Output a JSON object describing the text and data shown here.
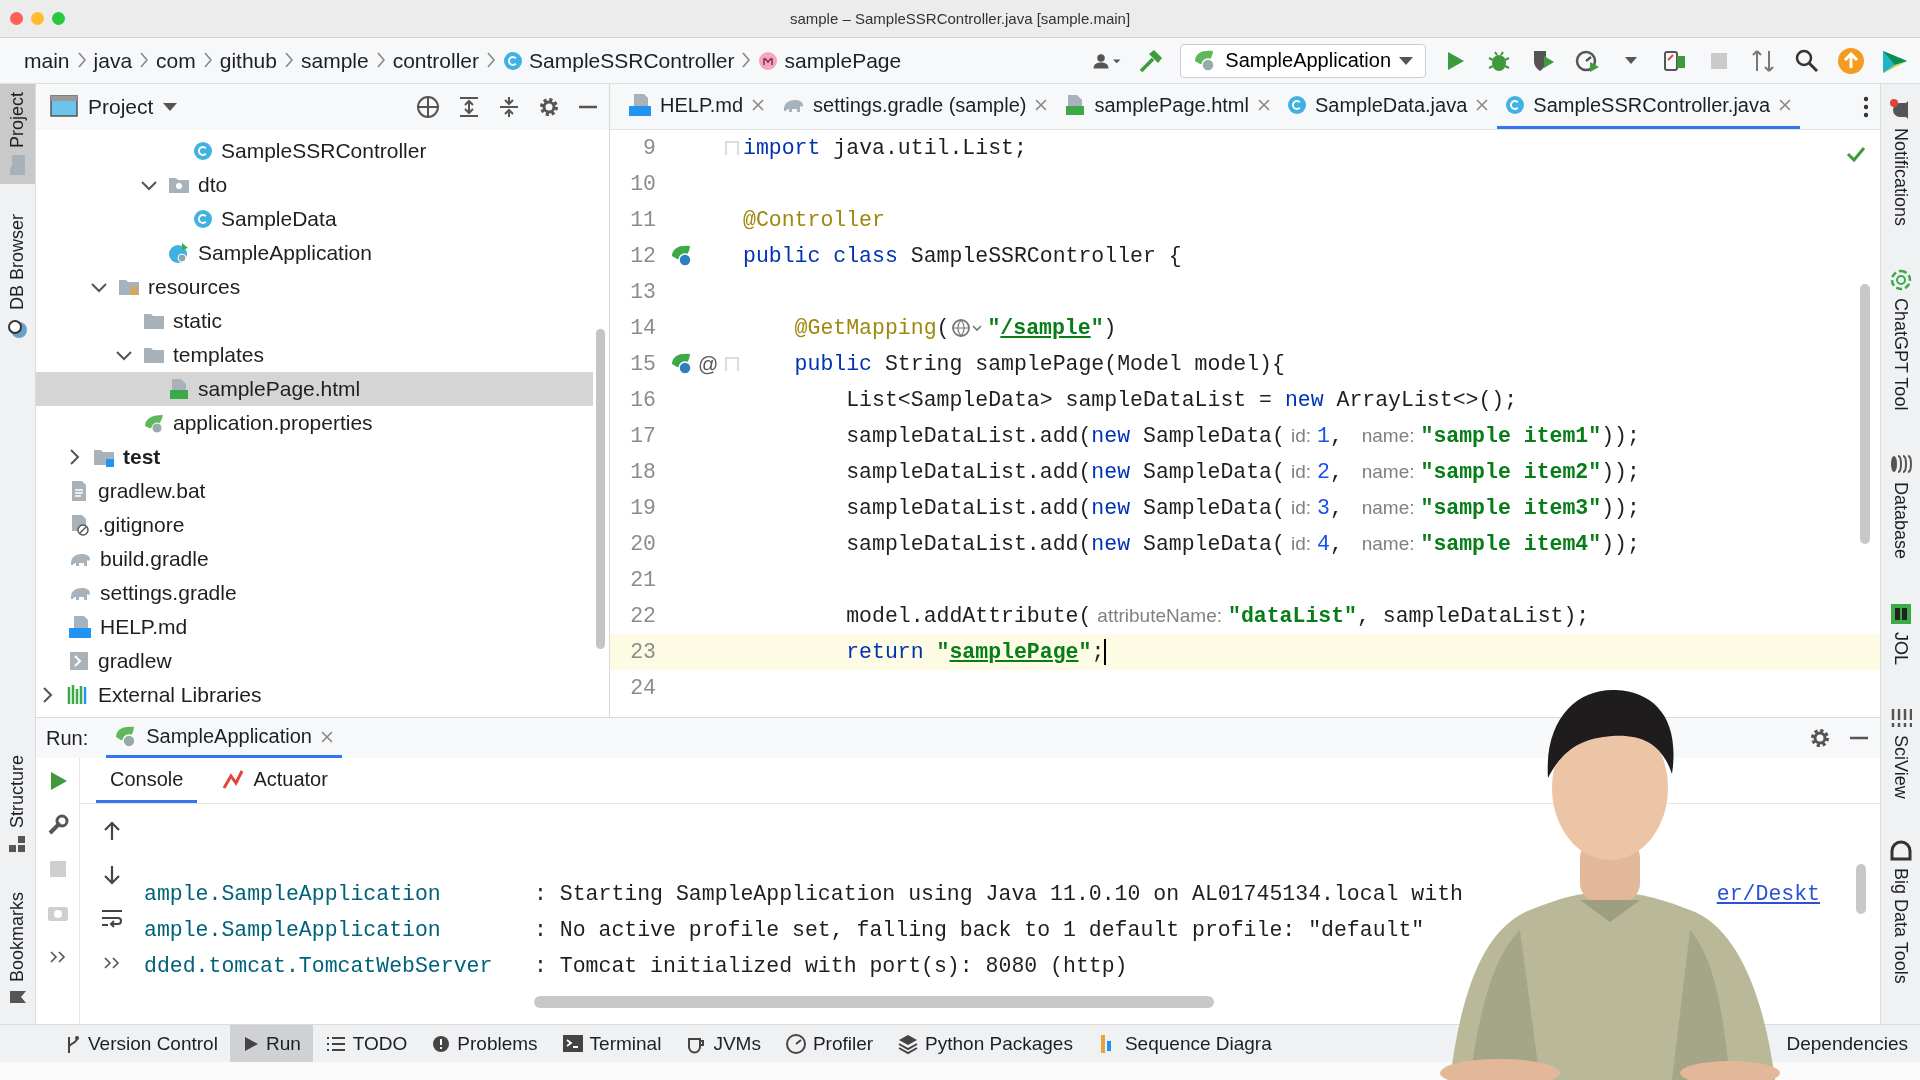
{
  "window": {
    "title": "sample – SampleSSRController.java [sample.main]"
  },
  "navigation": {
    "breadcrumbs": [
      {
        "label": "main",
        "kind": "package"
      },
      {
        "label": "java",
        "kind": "package"
      },
      {
        "label": "com",
        "kind": "package"
      },
      {
        "label": "github",
        "kind": "package"
      },
      {
        "label": "sample",
        "kind": "package"
      },
      {
        "label": "controller",
        "kind": "package"
      },
      {
        "label": "SampleSSRController",
        "kind": "class"
      },
      {
        "label": "samplePage",
        "kind": "method"
      }
    ],
    "tools_before": [
      {
        "kind": "user",
        "disabled": false
      },
      {
        "kind": "hammer",
        "disabled": false
      }
    ],
    "run_configuration": "SampleApplication",
    "tools_after": [
      {
        "kind": "run",
        "disabled": false
      },
      {
        "kind": "debug",
        "disabled": false
      },
      {
        "kind": "coverage",
        "disabled": false
      },
      {
        "kind": "profile",
        "disabled": false
      },
      {
        "kind": "caret",
        "disabled": false
      },
      {
        "kind": "build",
        "disabled": false
      },
      {
        "kind": "stop",
        "disabled": true
      },
      {
        "kind": "vcs",
        "disabled": false
      },
      {
        "kind": "search",
        "disabled": false
      },
      {
        "kind": "update",
        "disabled": false
      },
      {
        "kind": "logo",
        "disabled": false
      }
    ]
  },
  "left_strip": {
    "top": [
      {
        "label": "Project",
        "kind": "folder",
        "selected": true
      },
      {
        "label": "DB Browser",
        "kind": "db",
        "selected": false
      }
    ],
    "bottom": [
      {
        "label": "Structure",
        "kind": "structure",
        "selected": false
      },
      {
        "label": "Bookmarks",
        "kind": "bookmark",
        "selected": false
      }
    ]
  },
  "project_panel": {
    "title": "Project",
    "tree": [
      {
        "children": [
          {
            "children": [
              {
                "children": [
                  {
                    "children": [
                      {
                        "children": [
                          {
                            "children": [
                              {
                                "label": "SampleSSRController",
                                "kind": "class",
                                "selected": false
                              }
                            ]
                          },
                          {
                            "label": "dto",
                            "kind": "package",
                            "expanded": true,
                            "selected": false,
                            "children": [
                              {
                                "label": "SampleData",
                                "kind": "class",
                                "selected": false
                              }
                            ]
                          },
                          {
                            "label": "SampleApplication",
                            "kind": "spring-app",
                            "selected": false
                          }
                        ]
                      }
                    ]
                  },
                  {
                    "label": "resources",
                    "kind": "resources-folder",
                    "expanded": true,
                    "selected": false,
                    "children": [
                      {
                        "label": "static",
                        "kind": "folder",
                        "selected": false
                      },
                      {
                        "label": "templates",
                        "kind": "folder",
                        "expanded": true,
                        "selected": false,
                        "children": [
                          {
                            "label": "samplePage.html",
                            "kind": "html",
                            "selected": true
                          }
                        ]
                      },
                      {
                        "label": "application.properties",
                        "kind": "properties",
                        "selected": false
                      }
                    ]
                  }
                ]
              },
              {
                "label": "test",
                "kind": "test-folder",
                "expanded": false,
                "selected": false
              }
            ]
          },
          {
            "label": "gradlew.bat",
            "kind": "text-file",
            "selected": false
          },
          {
            "label": ".gitignore",
            "kind": "ignore-file",
            "selected": false
          },
          {
            "label": "build.gradle",
            "kind": "gradle",
            "selected": false
          },
          {
            "label": "settings.gradle",
            "kind": "gradle",
            "selected": false
          },
          {
            "label": "HELP.md",
            "kind": "markdown",
            "selected": false
          },
          {
            "label": "gradlew",
            "kind": "script",
            "selected": false
          }
        ]
      },
      {
        "label": "External Libraries",
        "kind": "libraries",
        "expanded": false,
        "selected": false
      }
    ]
  },
  "editor": {
    "tabs": [
      {
        "label": "HELP.md",
        "kind": "markdown",
        "selected": false
      },
      {
        "label": "settings.gradle (sample)",
        "kind": "gradle",
        "selected": false
      },
      {
        "label": "samplePage.html",
        "kind": "html",
        "selected": false
      },
      {
        "label": "SampleData.java",
        "kind": "class",
        "selected": false
      },
      {
        "label": "SampleSSRController.java",
        "kind": "class",
        "selected": true
      }
    ],
    "lines": [
      {
        "number": "9",
        "current": false,
        "fold": true,
        "bean_marker": false,
        "tokens": [
          {
            "kind": "kw",
            "text": "import"
          },
          {
            "kind": "plain",
            "text": " java.util.List;"
          }
        ]
      },
      {
        "number": "10",
        "current": false,
        "fold": false,
        "bean_marker": false
      },
      {
        "number": "11",
        "current": false,
        "fold": false,
        "bean_marker": false,
        "tokens": [
          {
            "kind": "annot",
            "text": "@Controller"
          }
        ]
      },
      {
        "number": "12",
        "current": false,
        "fold": false,
        "bean_marker": true,
        "tokens": [
          {
            "kind": "kw",
            "text": "public class"
          },
          {
            "kind": "plain",
            "text": " SampleSSRController {"
          }
        ]
      },
      {
        "number": "13",
        "current": false,
        "fold": false,
        "bean_marker": false
      },
      {
        "number": "14",
        "current": false,
        "fold": false,
        "bean_marker": false,
        "tokens": [
          {
            "kind": "annot",
            "text": "    @GetMapping"
          },
          {
            "kind": "plain",
            "text": "("
          },
          {
            "kind": "web"
          },
          {
            "kind": "str",
            "text": "\""
          },
          {
            "kind": "link",
            "text": "/sample"
          },
          {
            "kind": "str",
            "text": "\""
          },
          {
            "kind": "plain",
            "text": ")"
          }
        ]
      },
      {
        "number": "15",
        "current": false,
        "fold": true,
        "bean_marker": true,
        "gutter_text": "@",
        "tokens": [
          {
            "kind": "kw",
            "text": "    public"
          },
          {
            "kind": "plain",
            "text": " String samplePage(Model model){"
          }
        ]
      },
      {
        "number": "16",
        "current": false,
        "fold": false,
        "bean_marker": false,
        "tokens": [
          {
            "kind": "plain",
            "text": "        List<SampleData> sampleDataList = "
          },
          {
            "kind": "kw",
            "text": "new"
          },
          {
            "kind": "plain",
            "text": " ArrayList<>();"
          }
        ]
      },
      {
        "number": "17",
        "current": false,
        "fold": false,
        "bean_marker": false,
        "tokens": [
          {
            "kind": "plain",
            "text": "        sampleDataList.add("
          },
          {
            "kind": "kw",
            "text": "new"
          },
          {
            "kind": "plain",
            "text": " SampleData("
          },
          {
            "kind": "hint",
            "text": "id:"
          },
          {
            "kind": "num",
            "text": "1"
          },
          {
            "kind": "plain",
            "text": ", "
          },
          {
            "kind": "hint",
            "text": "name:"
          },
          {
            "kind": "str",
            "text": "\"sample item1\""
          },
          {
            "kind": "plain",
            "text": "));"
          }
        ]
      },
      {
        "number": "18",
        "current": false,
        "fold": false,
        "bean_marker": false,
        "tokens": [
          {
            "kind": "plain",
            "text": "        sampleDataList.add("
          },
          {
            "kind": "kw",
            "text": "new"
          },
          {
            "kind": "plain",
            "text": " SampleData("
          },
          {
            "kind": "hint",
            "text": "id:"
          },
          {
            "kind": "num",
            "text": "2"
          },
          {
            "kind": "plain",
            "text": ", "
          },
          {
            "kind": "hint",
            "text": "name:"
          },
          {
            "kind": "str",
            "text": "\"sample item2\""
          },
          {
            "kind": "plain",
            "text": "));"
          }
        ]
      },
      {
        "number": "19",
        "current": false,
        "fold": false,
        "bean_marker": false,
        "tokens": [
          {
            "kind": "plain",
            "text": "        sampleDataList.add("
          },
          {
            "kind": "kw",
            "text": "new"
          },
          {
            "kind": "plain",
            "text": " SampleData("
          },
          {
            "kind": "hint",
            "text": "id:"
          },
          {
            "kind": "num",
            "text": "3"
          },
          {
            "kind": "plain",
            "text": ", "
          },
          {
            "kind": "hint",
            "text": "name:"
          },
          {
            "kind": "str",
            "text": "\"sample item3\""
          },
          {
            "kind": "plain",
            "text": "));"
          }
        ]
      },
      {
        "number": "20",
        "current": false,
        "fold": false,
        "bean_marker": false,
        "tokens": [
          {
            "kind": "plain",
            "text": "        sampleDataList.add("
          },
          {
            "kind": "kw",
            "text": "new"
          },
          {
            "kind": "plain",
            "text": " SampleData("
          },
          {
            "kind": "hint",
            "text": "id:"
          },
          {
            "kind": "num",
            "text": "4"
          },
          {
            "kind": "plain",
            "text": ", "
          },
          {
            "kind": "hint",
            "text": "name:"
          },
          {
            "kind": "str",
            "text": "\"sample item4\""
          },
          {
            "kind": "plain",
            "text": "));"
          }
        ]
      },
      {
        "number": "21",
        "current": false,
        "fold": false,
        "bean_marker": false
      },
      {
        "number": "22",
        "current": false,
        "fold": false,
        "bean_marker": false,
        "tokens": [
          {
            "kind": "plain",
            "text": "        model.addAttribute("
          },
          {
            "kind": "hint",
            "text": "attributeName:"
          },
          {
            "kind": "str",
            "text": "\"dataList\""
          },
          {
            "kind": "plain",
            "text": ", sampleDataList);"
          }
        ]
      },
      {
        "number": "23",
        "current": true,
        "fold": false,
        "bean_marker": false,
        "tokens": [
          {
            "kind": "kw",
            "text": "        return "
          },
          {
            "kind": "str",
            "text": "\""
          },
          {
            "kind": "link",
            "text": "samplePage"
          },
          {
            "kind": "str",
            "text": "\""
          },
          {
            "kind": "plain",
            "text": ";"
          }
        ]
      },
      {
        "number": "24",
        "current": false,
        "fold": false,
        "bean_marker": false
      }
    ]
  },
  "right_strip": [
    {
      "label": "Notifications",
      "kind": "bell"
    },
    {
      "label": "ChatGPT Tool",
      "kind": "swirl"
    },
    {
      "label": "Database",
      "kind": "database"
    },
    {
      "label": "JOL",
      "kind": "jol"
    },
    {
      "label": "SciView",
      "kind": "sciview"
    },
    {
      "label": "Big Data Tools",
      "kind": "bigdata"
    }
  ],
  "run_panel": {
    "label": "Run:",
    "tabs": [
      {
        "label": "SampleApplication",
        "selected": true
      }
    ],
    "console_tabs": [
      {
        "label": "Console",
        "kind": "plain",
        "selected": true
      },
      {
        "label": "Actuator",
        "kind": "actuator",
        "selected": false
      }
    ],
    "side_tools": [
      {
        "kind": "run",
        "disabled": false
      },
      {
        "kind": "wrench",
        "disabled": false
      },
      {
        "kind": "stop",
        "disabled": true
      },
      {
        "kind": "camera",
        "disabled": true
      },
      {
        "kind": "more",
        "disabled": false
      }
    ],
    "console_tools": [
      {
        "kind": "up",
        "disabled": false
      },
      {
        "kind": "down",
        "disabled": false
      },
      {
        "kind": "wrap",
        "disabled": false
      },
      {
        "kind": "more",
        "disabled": false
      }
    ],
    "lines": [
      {
        "source": "ample.SampleApplication",
        "message": ": Starting SampleApplication using Java 11.0.10 on AL01745134.local with",
        "link": "er/Deskt"
      },
      {
        "source": "ample.SampleApplication",
        "message": ": No active profile set, falling back to 1 default profile: \"default\""
      },
      {
        "source": "dded.tomcat.TomcatWebServer",
        "message": ": Tomcat initialized with port(s): 8080 (http)"
      }
    ]
  },
  "bottom_bar": {
    "items": [
      {
        "label": "Version Control",
        "kind": "branch",
        "selected": false
      },
      {
        "label": "Run",
        "kind": "run-small",
        "selected": true
      },
      {
        "label": "TODO",
        "kind": "list",
        "selected": false
      },
      {
        "label": "Problems",
        "kind": "problem",
        "selected": false
      },
      {
        "label": "Terminal",
        "kind": "terminal",
        "selected": false
      },
      {
        "label": "JVMs",
        "kind": "cup",
        "selected": false
      },
      {
        "label": "Profiler",
        "kind": "gauge",
        "selected": false
      },
      {
        "label": "Python Packages",
        "kind": "layers",
        "selected": false
      },
      {
        "label": "Sequence Diagra",
        "kind": "sequence",
        "selected": false
      }
    ],
    "right_items": [
      {
        "label": "Dependencies",
        "selected": false
      }
    ]
  }
}
